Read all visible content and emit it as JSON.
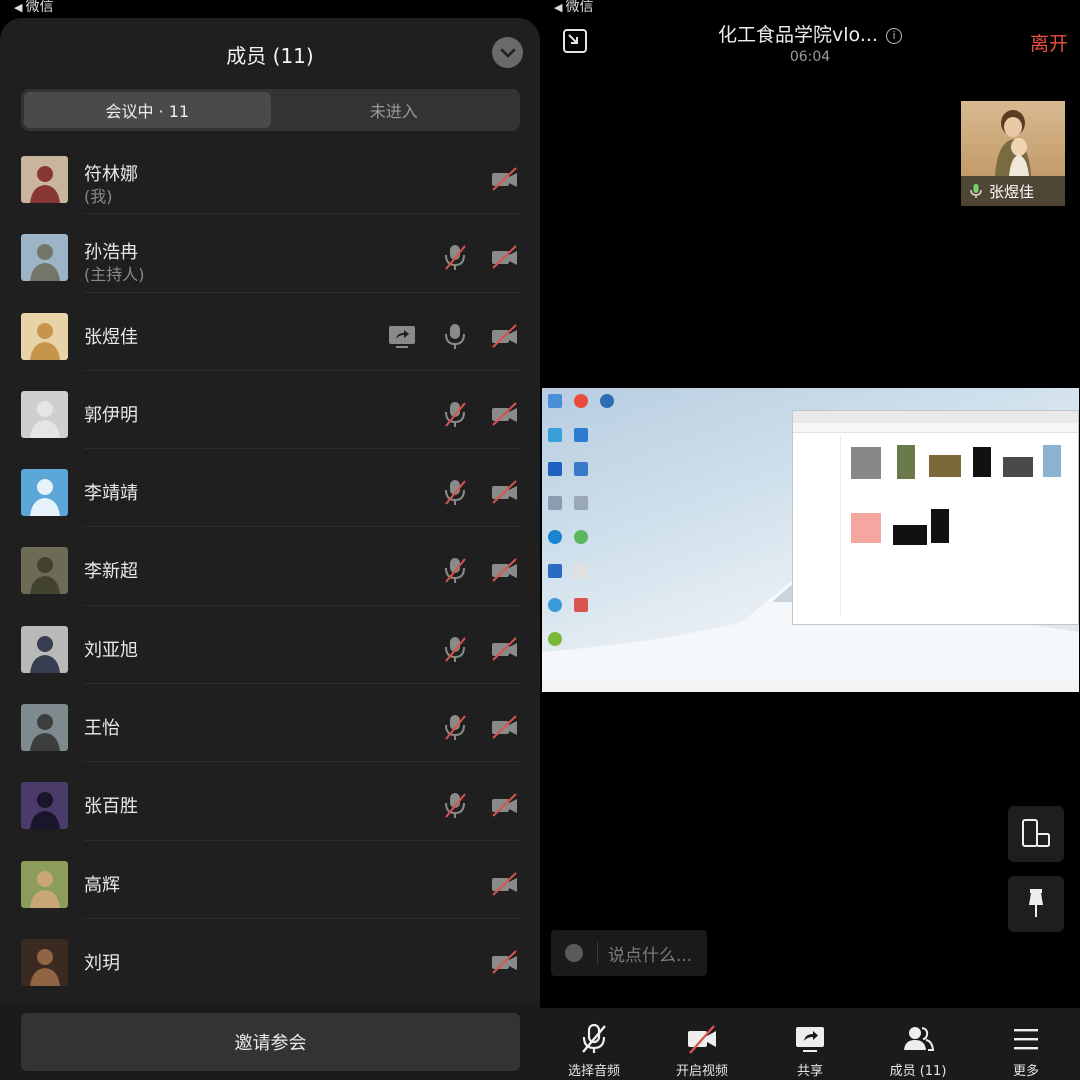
{
  "left": {
    "status_back": "微信",
    "title": "成员 (11)",
    "tabs": [
      {
        "label": "会议中 · 11",
        "active": true
      },
      {
        "label": "未进入",
        "active": false
      }
    ],
    "members": [
      {
        "name": "符林娜",
        "sub": "(我)",
        "mic": false,
        "share": false
      },
      {
        "name": "孙浩冉",
        "sub": "(主持人)",
        "mic": true,
        "share": false
      },
      {
        "name": "张煜佳",
        "sub": "",
        "mic": true,
        "mic_on": true,
        "share": true
      },
      {
        "name": "郭伊明",
        "sub": "",
        "mic": true,
        "share": false
      },
      {
        "name": "李靖靖",
        "sub": "",
        "mic": true,
        "share": false
      },
      {
        "name": "李新超",
        "sub": "",
        "mic": true,
        "share": false
      },
      {
        "name": "刘亚旭",
        "sub": "",
        "mic": true,
        "share": false
      },
      {
        "name": "王怡",
        "sub": "",
        "mic": true,
        "share": false
      },
      {
        "name": "张百胜",
        "sub": "",
        "mic": true,
        "share": false
      },
      {
        "name": "高辉",
        "sub": "",
        "mic": false,
        "share": false
      },
      {
        "name": "刘玥",
        "sub": "",
        "mic": false,
        "share": false
      }
    ],
    "invite_label": "邀请参会"
  },
  "right": {
    "status_back": "微信",
    "meeting_title": "化工食品学院vlo...",
    "meeting_time": "06:04",
    "leave_label": "离开",
    "pip_name": "张煜佳",
    "chat_placeholder": "说点什么...",
    "toolbar": [
      {
        "label": "选择音频",
        "icon": "mic-off-icon"
      },
      {
        "label": "开启视频",
        "icon": "video-off-icon"
      },
      {
        "label": "共享",
        "icon": "share-screen-icon"
      },
      {
        "label": "成员 (11)",
        "icon": "members-icon"
      },
      {
        "label": "更多",
        "icon": "menu-icon"
      }
    ]
  },
  "colors": {
    "leave": "#e9503f",
    "muted_slash": "#d9534f",
    "sheet_bg": "#1f1f1f"
  }
}
